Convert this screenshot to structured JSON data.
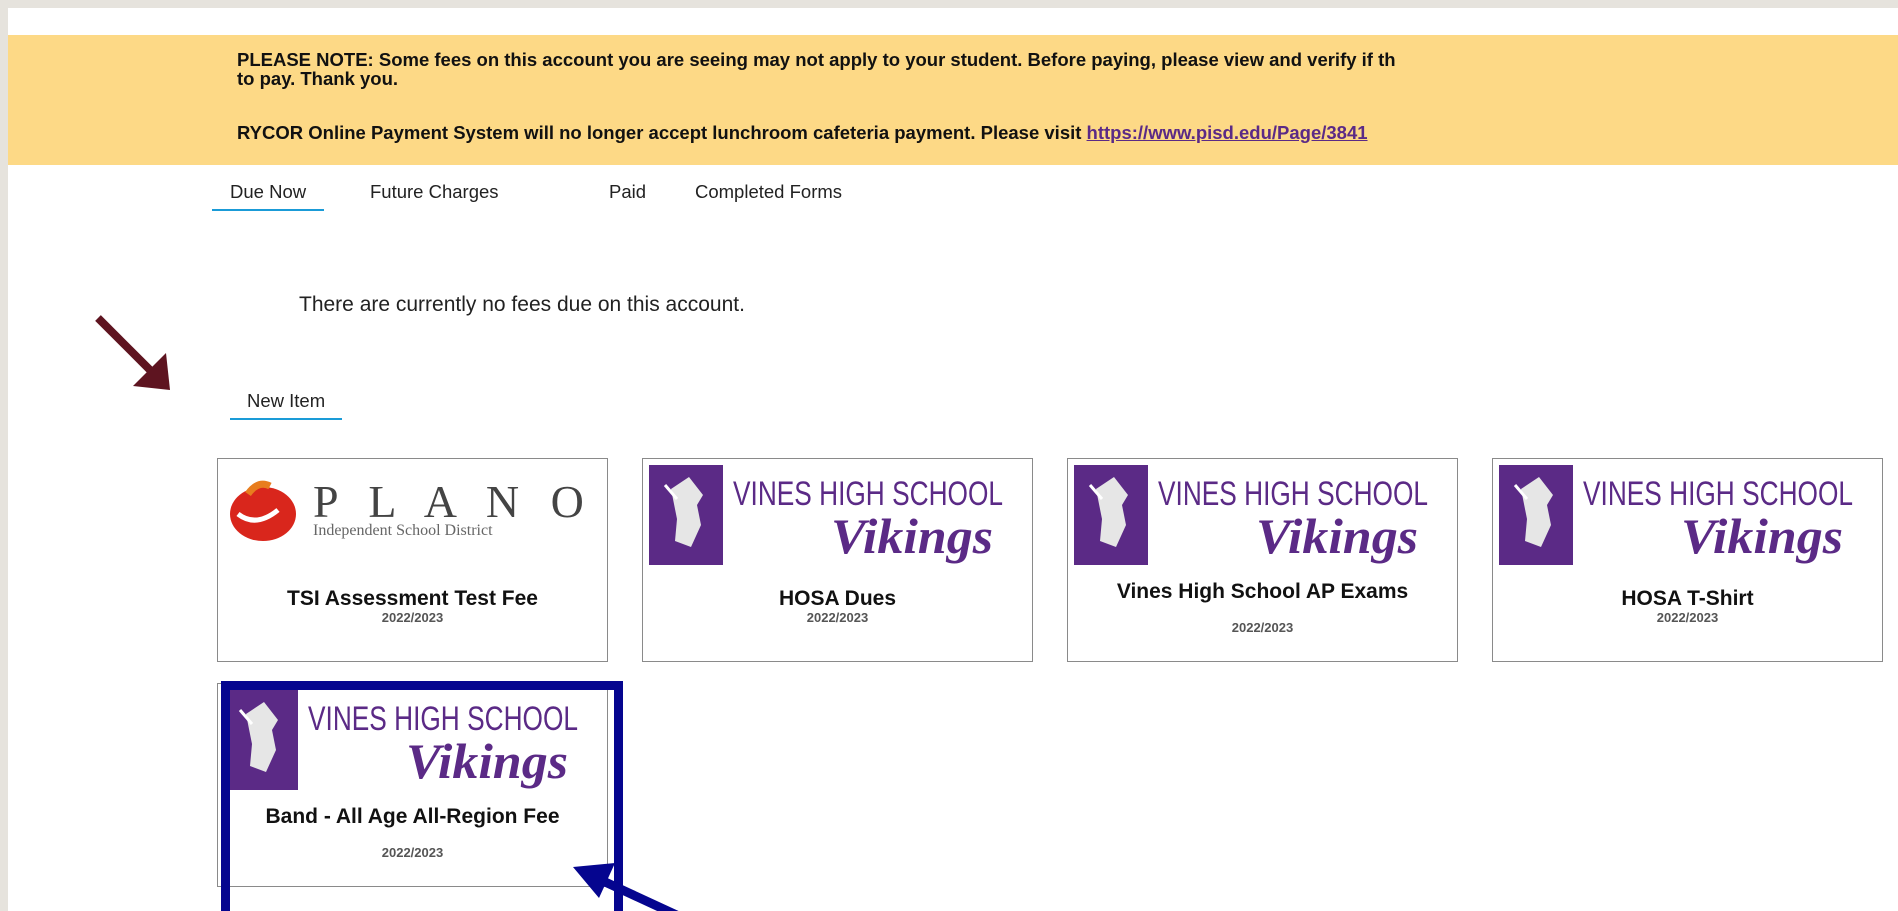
{
  "banner": {
    "note_line1": "PLEASE NOTE: Some fees on this account you are seeing may not apply to your student. Before paying, please view and verify if th",
    "note_line2": "to pay. Thank you.",
    "rycor_text": "RYCOR Online Payment System will no longer accept lunchroom cafeteria payment. Please visit ",
    "rycor_link": "https://www.pisd.edu/Page/3841"
  },
  "tabs": [
    "Due Now",
    "Future Charges",
    "Paid",
    "Completed Forms"
  ],
  "empty_message": "There are currently no fees due on this account.",
  "section_tab": "New Item",
  "plano_logo": {
    "word": "P L A N O",
    "sub": "Independent School District"
  },
  "vines_logo": {
    "line1": "VINES HIGH SCHOOL",
    "line2": "Vikings"
  },
  "items": [
    {
      "title": "TSI Assessment Test Fee",
      "year": "2022/2023",
      "logo": "plano"
    },
    {
      "title": "HOSA Dues",
      "year": "2022/2023",
      "logo": "vines"
    },
    {
      "title": "Vines High School AP Exams",
      "year": "2022/2023",
      "logo": "vines"
    },
    {
      "title": "HOSA T-Shirt",
      "year": "2022/2023",
      "logo": "vines"
    },
    {
      "title": "Band - All Age All-Region Fee",
      "year": "2022/2023",
      "logo": "vines"
    }
  ],
  "colors": {
    "banner_bg": "#fdd986",
    "link": "#5b2a86",
    "tab_underline": "#1a9bd7",
    "vikings_purple": "#5b2a86",
    "highlight_border": "#05058f",
    "maroon_arrow": "#5e1420",
    "blue_arrow": "#05058f"
  }
}
